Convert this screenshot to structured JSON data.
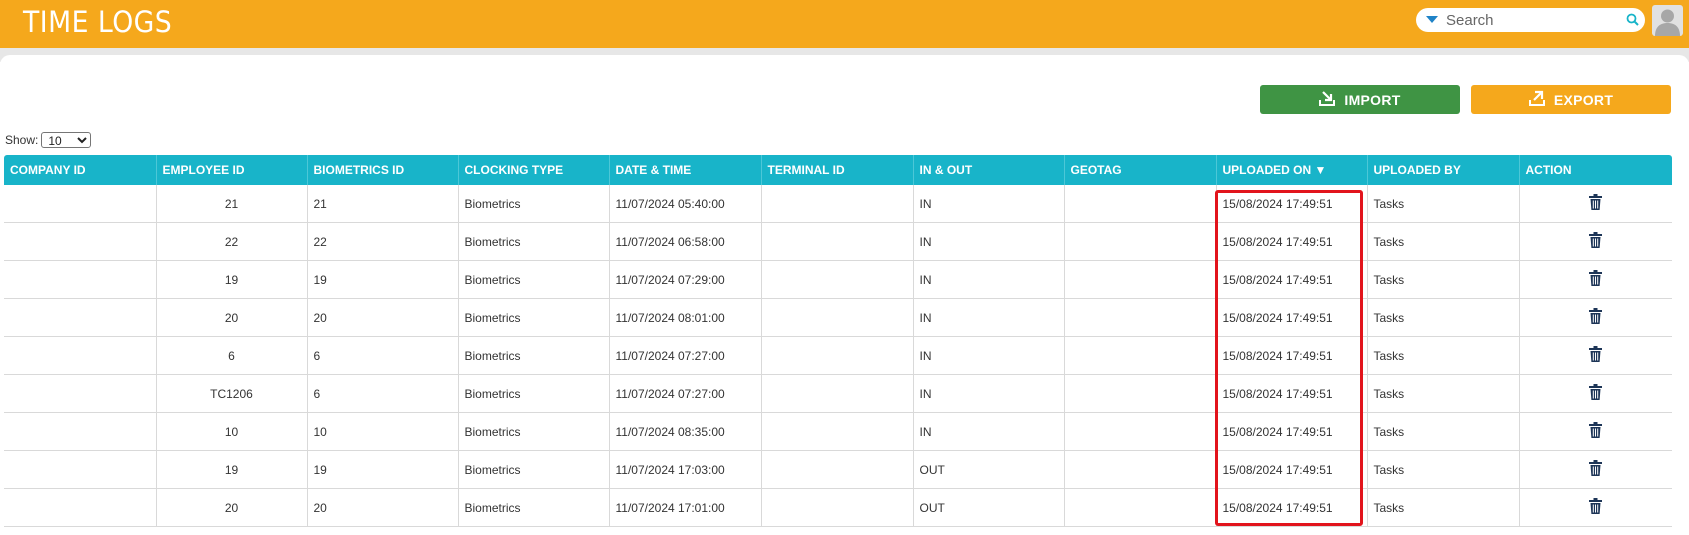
{
  "header": {
    "title": "TIME LOGS",
    "search_placeholder": "Search"
  },
  "toolbar": {
    "import_label": "IMPORT",
    "export_label": "EXPORT"
  },
  "show": {
    "label": "Show:",
    "selected": "10"
  },
  "table": {
    "columns": [
      "COMPANY ID",
      "EMPLOYEE ID",
      "BIOMETRICS ID",
      "CLOCKING TYPE",
      "DATE & TIME",
      "TERMINAL ID",
      "IN & OUT",
      "GEOTAG",
      "UPLOADED ON ▼",
      "UPLOADED BY",
      "ACTION"
    ],
    "rows": [
      {
        "company_id": "",
        "employee_id": "21",
        "biometrics_id": "21",
        "clocking_type": "Biometrics",
        "date_time": "11/07/2024 05:40:00",
        "terminal_id": "",
        "in_out": "IN",
        "geotag": "",
        "uploaded_on": "15/08/2024 17:49:51",
        "uploaded_by": "Tasks"
      },
      {
        "company_id": "",
        "employee_id": "22",
        "biometrics_id": "22",
        "clocking_type": "Biometrics",
        "date_time": "11/07/2024 06:58:00",
        "terminal_id": "",
        "in_out": "IN",
        "geotag": "",
        "uploaded_on": "15/08/2024 17:49:51",
        "uploaded_by": "Tasks"
      },
      {
        "company_id": "",
        "employee_id": "19",
        "biometrics_id": "19",
        "clocking_type": "Biometrics",
        "date_time": "11/07/2024 07:29:00",
        "terminal_id": "",
        "in_out": "IN",
        "geotag": "",
        "uploaded_on": "15/08/2024 17:49:51",
        "uploaded_by": "Tasks"
      },
      {
        "company_id": "",
        "employee_id": "20",
        "biometrics_id": "20",
        "clocking_type": "Biometrics",
        "date_time": "11/07/2024 08:01:00",
        "terminal_id": "",
        "in_out": "IN",
        "geotag": "",
        "uploaded_on": "15/08/2024 17:49:51",
        "uploaded_by": "Tasks"
      },
      {
        "company_id": "",
        "employee_id": "6",
        "biometrics_id": "6",
        "clocking_type": "Biometrics",
        "date_time": "11/07/2024 07:27:00",
        "terminal_id": "",
        "in_out": "IN",
        "geotag": "",
        "uploaded_on": "15/08/2024 17:49:51",
        "uploaded_by": "Tasks"
      },
      {
        "company_id": "",
        "employee_id": "TC1206",
        "biometrics_id": "6",
        "clocking_type": "Biometrics",
        "date_time": "11/07/2024 07:27:00",
        "terminal_id": "",
        "in_out": "IN",
        "geotag": "",
        "uploaded_on": "15/08/2024 17:49:51",
        "uploaded_by": "Tasks"
      },
      {
        "company_id": "",
        "employee_id": "10",
        "biometrics_id": "10",
        "clocking_type": "Biometrics",
        "date_time": "11/07/2024 08:35:00",
        "terminal_id": "",
        "in_out": "IN",
        "geotag": "",
        "uploaded_on": "15/08/2024 17:49:51",
        "uploaded_by": "Tasks"
      },
      {
        "company_id": "",
        "employee_id": "19",
        "biometrics_id": "19",
        "clocking_type": "Biometrics",
        "date_time": "11/07/2024 17:03:00",
        "terminal_id": "",
        "in_out": "OUT",
        "geotag": "",
        "uploaded_on": "15/08/2024 17:49:51",
        "uploaded_by": "Tasks"
      },
      {
        "company_id": "",
        "employee_id": "20",
        "biometrics_id": "20",
        "clocking_type": "Biometrics",
        "date_time": "11/07/2024 17:01:00",
        "terminal_id": "",
        "in_out": "OUT",
        "geotag": "",
        "uploaded_on": "15/08/2024 17:49:51",
        "uploaded_by": "Tasks"
      }
    ]
  },
  "icons": {
    "search": "search-icon",
    "dropdown": "caret-down-icon",
    "avatar": "user-avatar-icon",
    "import": "import-icon",
    "export": "export-icon",
    "delete": "trash-icon"
  },
  "colors": {
    "header": "#f5a81c",
    "table_header": "#18b4c9",
    "import_button": "#3f9444",
    "export_button": "#f5a81c",
    "highlight": "#e2141c"
  }
}
